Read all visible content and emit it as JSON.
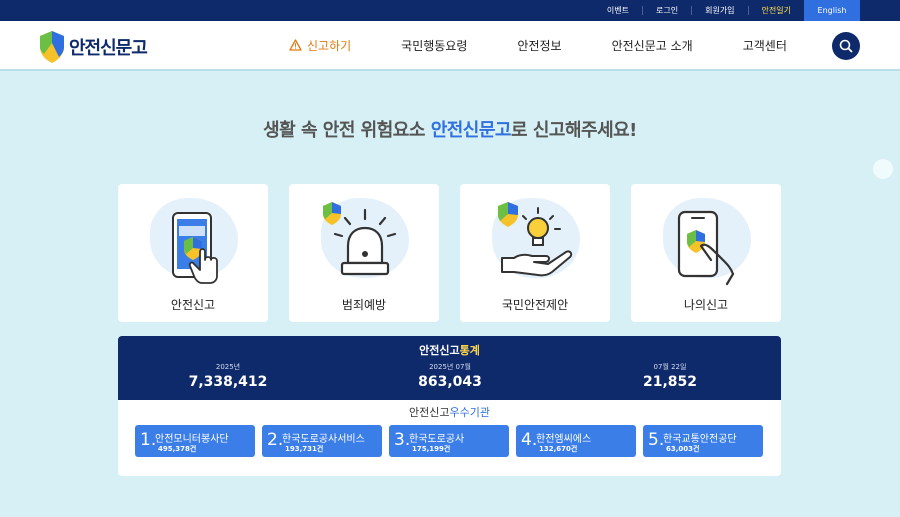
{
  "topbar": {
    "links": [
      "이벤트",
      "로그인",
      "회원가입",
      "안전일기"
    ],
    "english": "English"
  },
  "header": {
    "logo_text": "안전신문고",
    "nav": [
      "신고하기",
      "국민행동요령",
      "안전정보",
      "안전신문고 소개",
      "고객센터"
    ]
  },
  "hero": {
    "headline_prefix": "생활 속 안전 위험요소 ",
    "headline_accent": "안전신문고",
    "headline_suffix": "로 신고해주세요!"
  },
  "cards": [
    {
      "label": "안전신고",
      "icon": "phone-tap-icon"
    },
    {
      "label": "범죄예방",
      "icon": "siren-icon"
    },
    {
      "label": "국민안전제안",
      "icon": "lightbulb-hand-icon"
    },
    {
      "label": "나의신고",
      "icon": "phone-hand-icon"
    }
  ],
  "stats": {
    "title_prefix": "안전신고",
    "title_accent": "통계",
    "items": [
      {
        "caption": "2025년",
        "value": "7,338,412"
      },
      {
        "caption": "2025년 07월",
        "value": "863,043"
      },
      {
        "caption": "07월 22일",
        "value": "21,852"
      }
    ],
    "org_title_prefix": "안전신고",
    "org_title_accent": "우수기관",
    "orgs": [
      {
        "rank": "1.",
        "name": "안전모니터봉사단",
        "count": "495,378건"
      },
      {
        "rank": "2.",
        "name": "한국도로공사서비스",
        "count": "193,731건"
      },
      {
        "rank": "3.",
        "name": "한국도로공사",
        "count": "175,199건"
      },
      {
        "rank": "4.",
        "name": "한전엠씨에스",
        "count": "132,670건"
      },
      {
        "rank": "5.",
        "name": "한국교통안전공단",
        "count": "63,003건"
      }
    ]
  },
  "colors": {
    "navy": "#0f2a6b",
    "accent_blue": "#2f6fe0",
    "warning_orange": "#e07a10",
    "highlight_yellow": "#ffe14a",
    "background": "#d6f0f5"
  }
}
